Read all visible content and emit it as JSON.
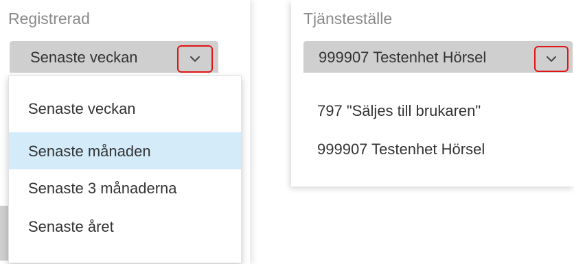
{
  "registrerad": {
    "label": "Registrerad",
    "selected": "Senaste veckan",
    "options": [
      {
        "label": "Senaste veckan",
        "highlighted": false
      },
      {
        "label": "Senaste månaden",
        "highlighted": true
      },
      {
        "label": "Senaste 3 månaderna",
        "highlighted": false
      },
      {
        "label": "Senaste året",
        "highlighted": false
      }
    ]
  },
  "tjanstestalle": {
    "label": "Tjänsteställe",
    "selected": "999907 Testenhet Hörsel",
    "options": [
      {
        "label": "797 \"Säljes till brukaren\""
      },
      {
        "label": "999907 Testenhet Hörsel"
      }
    ]
  },
  "icons": {
    "dropdown_toggle": "chevron-down-icon"
  },
  "colors": {
    "select_background": "#cfcfcf",
    "highlight_background": "#d4ebfa",
    "emphasis_border": "#e01414",
    "label_text": "#8a8a8a"
  }
}
